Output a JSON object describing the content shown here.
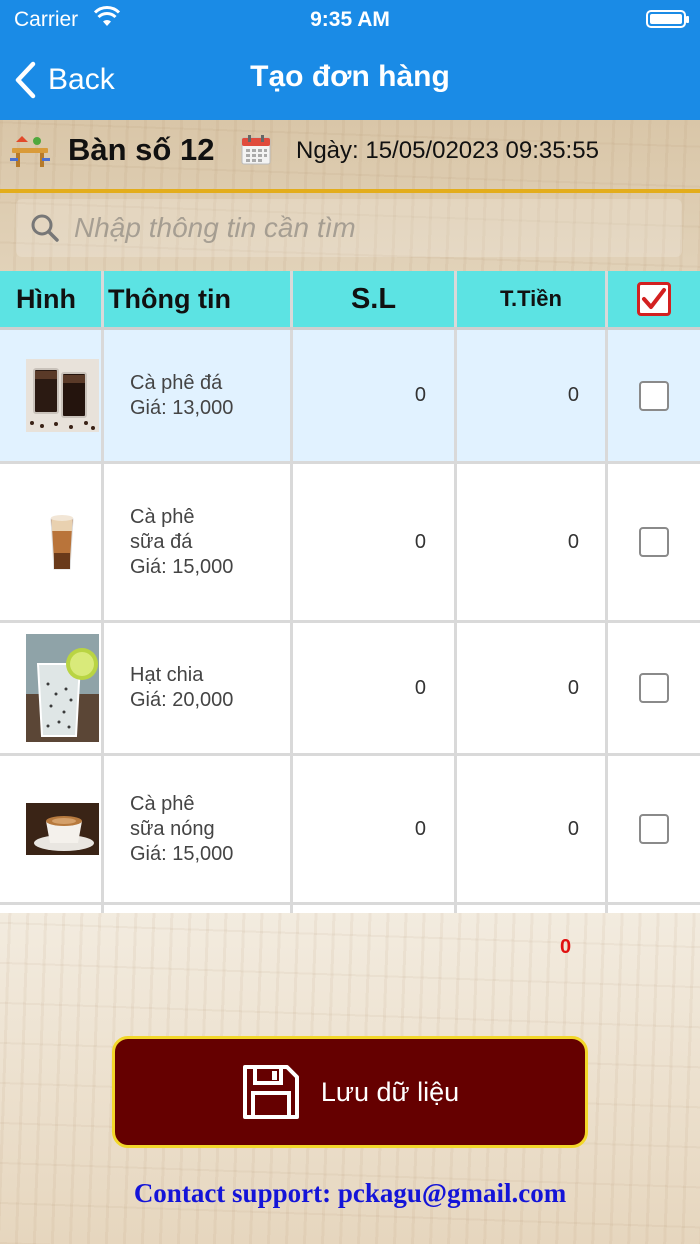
{
  "status_bar": {
    "carrier": "Carrier",
    "time": "9:35 AM"
  },
  "nav": {
    "back_label": "Back",
    "title": "Tạo đơn hàng"
  },
  "info": {
    "table_label": "Bàn số 12",
    "date_text": "Ngày: 15/05/02023 09:35:55"
  },
  "search": {
    "placeholder": "Nhập thông tin cần tìm"
  },
  "table": {
    "headers": {
      "image": "Hình",
      "info": "Thông tin",
      "qty": "S.L",
      "amount": "T.Tiền"
    },
    "rows": [
      {
        "name": "Cà phê đá",
        "price": "Giá: 13,000",
        "qty": "0",
        "amount": "0",
        "image": "iced-coffee"
      },
      {
        "name": "Cà phê\nsữa đá",
        "price": "Giá: 15,000",
        "qty": "0",
        "amount": "0",
        "image": "iced-milk-coffee"
      },
      {
        "name": "Hạt chia",
        "price": "Giá: 20,000",
        "qty": "0",
        "amount": "0",
        "image": "chia-drink"
      },
      {
        "name": "Cà phê\nsữa nóng",
        "price": "Giá: 15,000",
        "qty": "0",
        "amount": "0",
        "image": "hot-milk-coffee"
      }
    ]
  },
  "total": "0",
  "save_button": {
    "label": "Lưu dữ liệu"
  },
  "contact": "Contact support: pckagu@gmail.com",
  "colors": {
    "nav_bg": "#1a8be6",
    "header_bg": "#5ce3e3",
    "button_bg": "#650000",
    "button_border": "#f2d72a",
    "accent_line": "#e3ad1c",
    "total": "#e01010",
    "contact": "#1414d8"
  }
}
